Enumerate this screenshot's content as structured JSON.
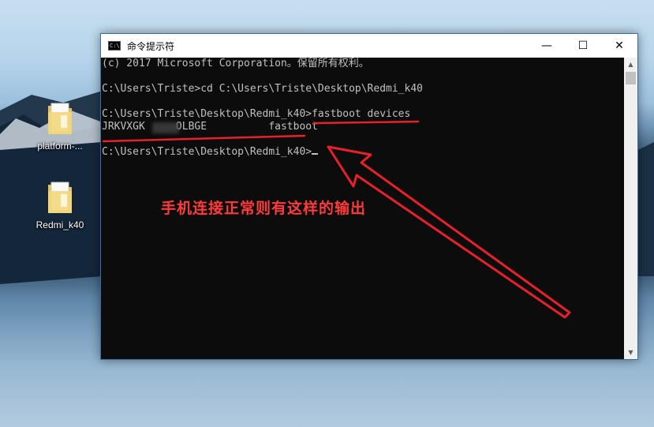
{
  "desktop": {
    "icons": [
      {
        "label": "platform-..."
      },
      {
        "label": "Redmi_k40"
      }
    ]
  },
  "window": {
    "title": "命令提示符",
    "icon_text": "C:\\",
    "controls": {
      "minimize": "—",
      "maximize": "☐",
      "close": "✕"
    }
  },
  "console": {
    "lines": [
      "(c) 2017 Microsoft Corporation。保留所有权利。",
      "",
      "C:\\Users\\Triste>cd C:\\Users\\Triste\\Desktop\\Redmi_k40",
      "",
      "C:\\Users\\Triste\\Desktop\\Redmi_k40>fastboot devices",
      "JRKVXGK     OLBGE          fastboot",
      "",
      "C:\\Users\\Triste\\Desktop\\Redmi_k40>"
    ]
  },
  "annotation": {
    "text": "手机连接正常则有这样的输出",
    "color": "#ff3a3a"
  },
  "colors": {
    "console_bg": "#0c0c0c",
    "console_fg": "#c0c0c0",
    "annotation_red": "#e8202a"
  }
}
